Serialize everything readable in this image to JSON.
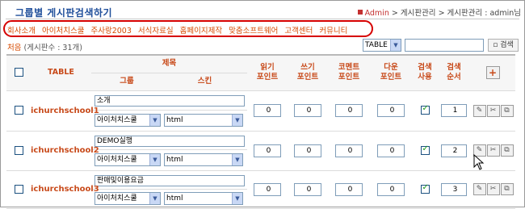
{
  "header": {
    "title": "그룹별 게시판검색하기",
    "crumb_admin": "Admin",
    "crumb_rest": " > 게시판관리 > 게시판관리 : admin님"
  },
  "categories": [
    "회사소개",
    "아이처치스쿨",
    "주사랑2003",
    "서식자료실",
    "홈페이지제작",
    "맞춤소프트웨어",
    "고객센터",
    "커뮤니티"
  ],
  "count": {
    "first_label": "처음",
    "total_text": "(게시판수 : 31개)"
  },
  "search": {
    "select_value": "TABLE",
    "input_value": "",
    "button_label": "검색"
  },
  "columns": {
    "table": "TABLE",
    "title": "제목",
    "group": "그룹",
    "skin": "스킨",
    "read_point_1": "읽기",
    "read_point_2": "포인트",
    "write_point_1": "쓰기",
    "write_point_2": "포인트",
    "comment_point_1": "코멘트",
    "comment_point_2": "포인트",
    "download_point_1": "다운",
    "download_point_2": "포인트",
    "search_use_1": "검색",
    "search_use_2": "사용",
    "search_order_1": "검색",
    "search_order_2": "순서"
  },
  "rows": [
    {
      "table": "ichurchschool1",
      "title": "소개",
      "group": "아이처치스쿨",
      "skin": "html",
      "read": "0",
      "write": "0",
      "comment": "0",
      "download": "0",
      "search_use": true,
      "order": "1"
    },
    {
      "table": "ichurchschool2",
      "title": "DEMO실행",
      "group": "아이처치스쿨",
      "skin": "html",
      "read": "0",
      "write": "0",
      "comment": "0",
      "download": "0",
      "search_use": true,
      "order": "2"
    },
    {
      "table": "ichurchschool3",
      "title": "판매및이용요금",
      "group": "아이처치스쿨",
      "skin": "html",
      "read": "0",
      "write": "0",
      "comment": "0",
      "download": "0",
      "search_use": true,
      "order": "3"
    }
  ],
  "colors": {
    "accent": "#c84a1a",
    "title": "#1f4e9a",
    "highlight_oval": "#d60000"
  }
}
